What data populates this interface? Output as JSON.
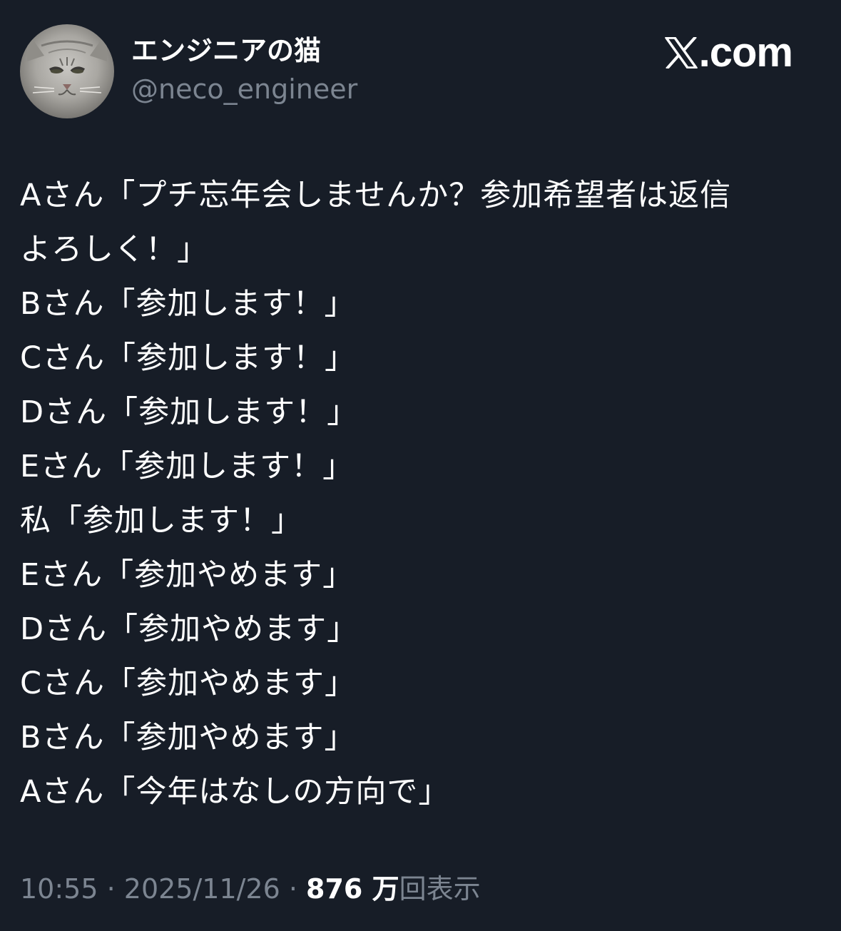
{
  "author": {
    "name": "エンジニアの猫",
    "handle": "@neco_engineer",
    "avatar_icon": "cat-face-avatar"
  },
  "brand": {
    "icon": "x-logo-icon",
    "domain": ".com"
  },
  "tweet": {
    "lines": [
      "Aさん「プチ忘年会しませんか？参加希望者は返信",
      "よろしく！」",
      "Bさん「参加します！」",
      "Cさん「参加します！」",
      "Dさん「参加します！」",
      "Eさん「参加します！」",
      "私「参加します！」",
      "Eさん「参加やめます」",
      "Dさん「参加やめます」",
      "Cさん「参加やめます」",
      "Bさん「参加やめます」",
      "Aさん「今年はなしの方向で」"
    ]
  },
  "meta": {
    "time": "10:55",
    "separator": " · ",
    "date": "2025/11/26",
    "views_count": "876 万",
    "views_label": "回表示"
  },
  "colors": {
    "background": "#171d27",
    "text": "#ffffff",
    "secondary_text": "#7c8591"
  }
}
